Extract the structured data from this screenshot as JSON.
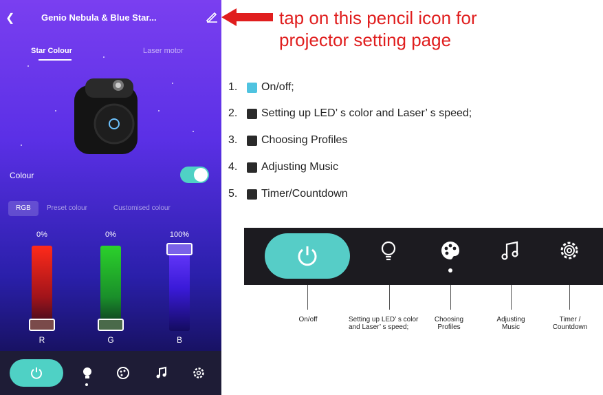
{
  "phone": {
    "title": "Genio Nebula & Blue Star...",
    "back_icon": "chevron-left-icon",
    "edit_icon": "pencil-icon",
    "tabs": [
      "Star Colour",
      "Laser motor"
    ],
    "colour_label": "Colour",
    "colour_toggle_on": true,
    "mode_tabs": [
      "RGB",
      "Preset colour",
      "Customised colour"
    ],
    "sliders": [
      {
        "label": "R",
        "percent_text": "0%",
        "level": 0,
        "color": "#ff2a1a"
      },
      {
        "label": "G",
        "percent_text": "0%",
        "level": 0,
        "color": "#2bd12b"
      },
      {
        "label": "B",
        "percent_text": "100%",
        "level": 1,
        "color": "#6b3cff"
      }
    ],
    "bottom_nav_icons": [
      "power-icon",
      "bulb-icon",
      "palette-icon",
      "music-icon",
      "gear-icon"
    ]
  },
  "annotation": {
    "line1": "tap on this pencil icon for",
    "line2": "projector setting page",
    "color": "#e01e1e"
  },
  "list": [
    {
      "num": "1.",
      "icon": "power-icon",
      "text": "On/off;"
    },
    {
      "num": "2.",
      "icon": "bulb-icon",
      "text": "Setting up LED’ s color and Laser’ s speed;"
    },
    {
      "num": "3.",
      "icon": "palette-icon",
      "text": "Choosing Profiles"
    },
    {
      "num": "4.",
      "icon": "music-icon",
      "text": "Adjusting Music"
    },
    {
      "num": "5.",
      "icon": "gear-icon",
      "text": "Timer/Countdown"
    }
  ],
  "strip_labels": [
    {
      "text": "On/off"
    },
    {
      "text": "Setting up LED’ s color and Laser’ s speed;"
    },
    {
      "text": "Choosing Profiles"
    },
    {
      "text": "Adjusting Music"
    },
    {
      "text": "Timer / Countdown"
    }
  ],
  "colors": {
    "accent": "#4fd1c5",
    "strip_bg": "#1c1b20"
  }
}
